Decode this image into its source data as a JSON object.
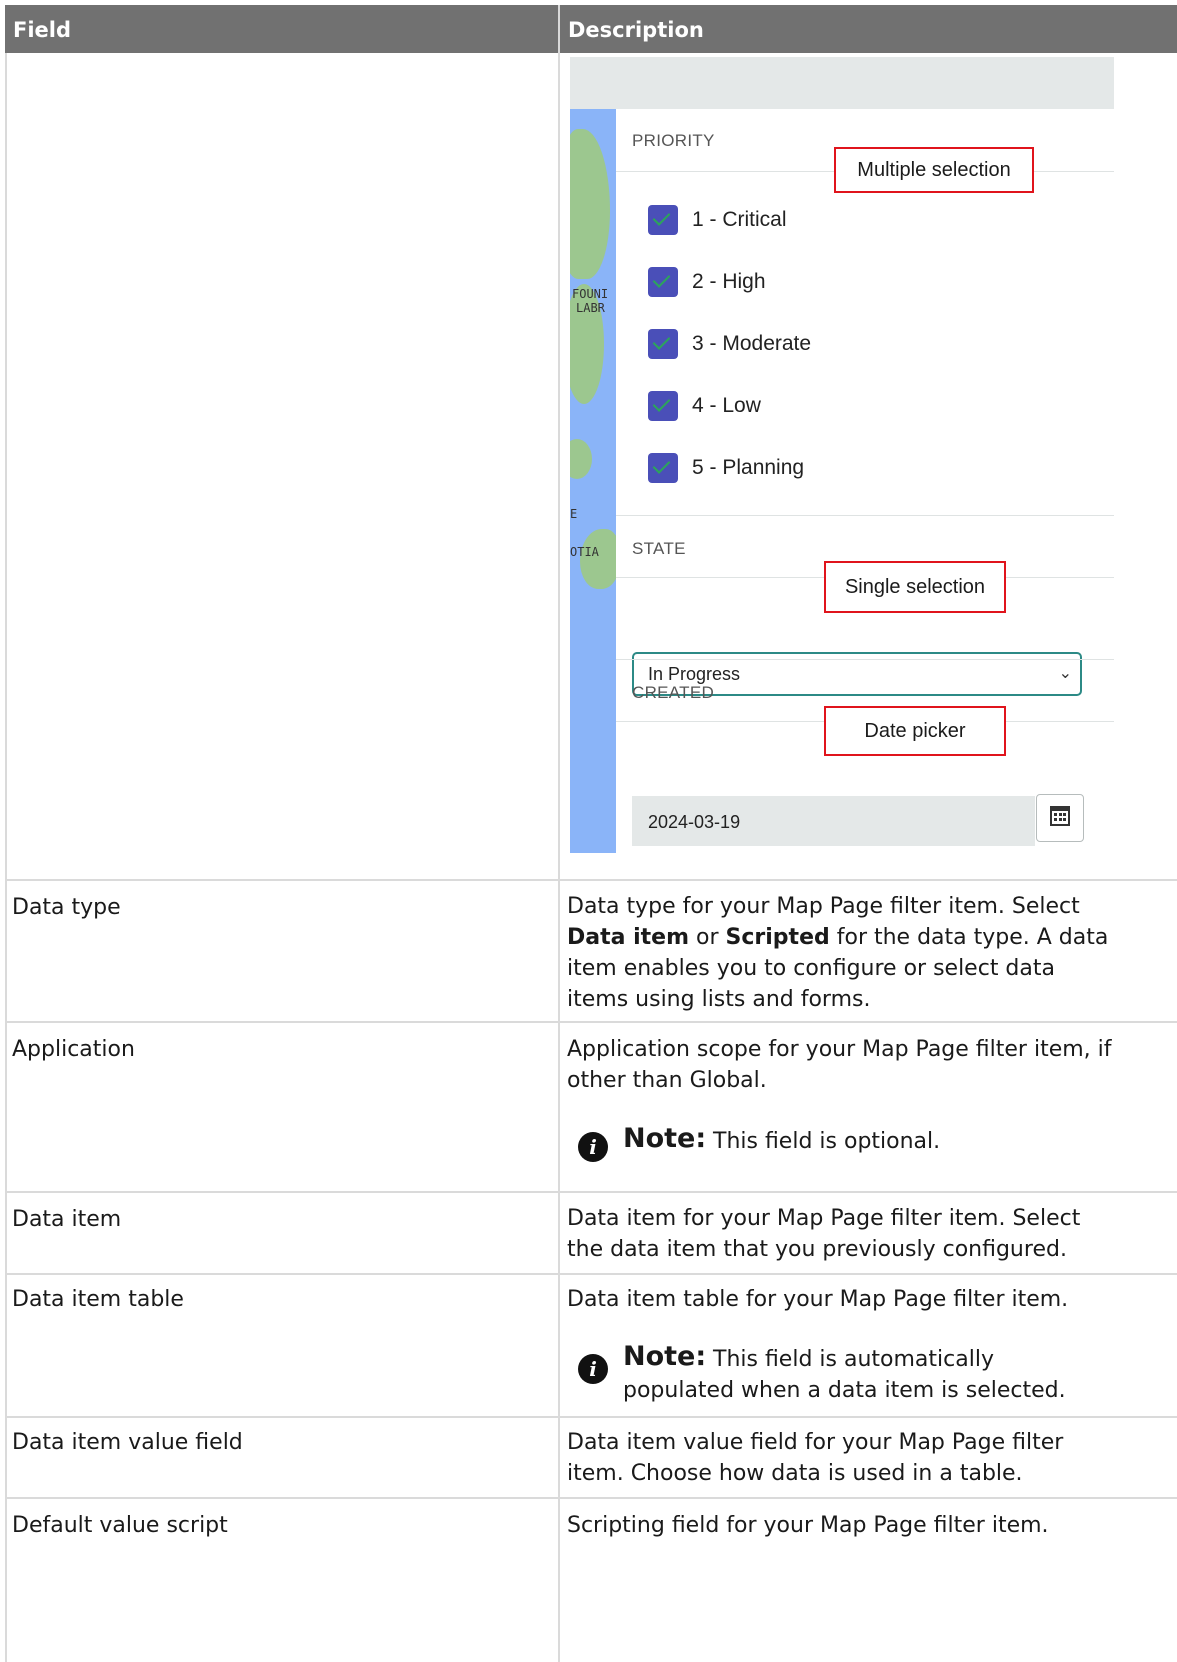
{
  "table": {
    "headers": {
      "field": "Field",
      "description": "Description"
    },
    "rows": [
      {
        "field": "Data type",
        "desc_pre": "Data type for your Map Page filter item. Select ",
        "desc_b1": "Data item",
        "desc_mid": " or ",
        "desc_b2": "Scripted",
        "desc_post": " for the data type. A data item enables you to configure or select data items using lists and forms."
      },
      {
        "field": "Application",
        "description": "Application scope for your Map Page filter item, if other than Global.",
        "note_label": "Note:",
        "note_text": "This field is optional."
      },
      {
        "field": "Data item",
        "description": "Data item for your Map Page filter item. Select the data item that you previously configured."
      },
      {
        "field": "Data item table",
        "description": "Data item table for your Map Page filter item.",
        "note_label": "Note:",
        "note_text_line1": "This field is automatically",
        "note_text_line2": "populated when a data item is selected."
      },
      {
        "field": "Data item value field",
        "description": "Data item value field for your Map Page filter item. Choose how data is used in a table."
      },
      {
        "field": "Default value script",
        "description": "Scripting field for your Map Page filter item."
      }
    ]
  },
  "screenshot": {
    "map_labels": [
      "FOUNI",
      "LABR",
      "E",
      "OTIA"
    ],
    "priority": {
      "title": "PRIORITY",
      "options": [
        "1 - Critical",
        "2 - High",
        "3 - Moderate",
        "4 - Low",
        "5 - Planning"
      ]
    },
    "state": {
      "title": "STATE",
      "selected": "In Progress"
    },
    "created": {
      "title": "CREATED",
      "value": "2024-03-19"
    },
    "callouts": {
      "multiple": "Multiple selection",
      "single": "Single selection",
      "date": "Date picker"
    },
    "colors": {
      "checkbox": "#4a4fb8",
      "callout_border": "#e0141c",
      "select_border": "#2c8a86"
    },
    "icons": [
      "check-icon",
      "chevron-down-icon",
      "calendar-icon",
      "info-icon"
    ]
  }
}
